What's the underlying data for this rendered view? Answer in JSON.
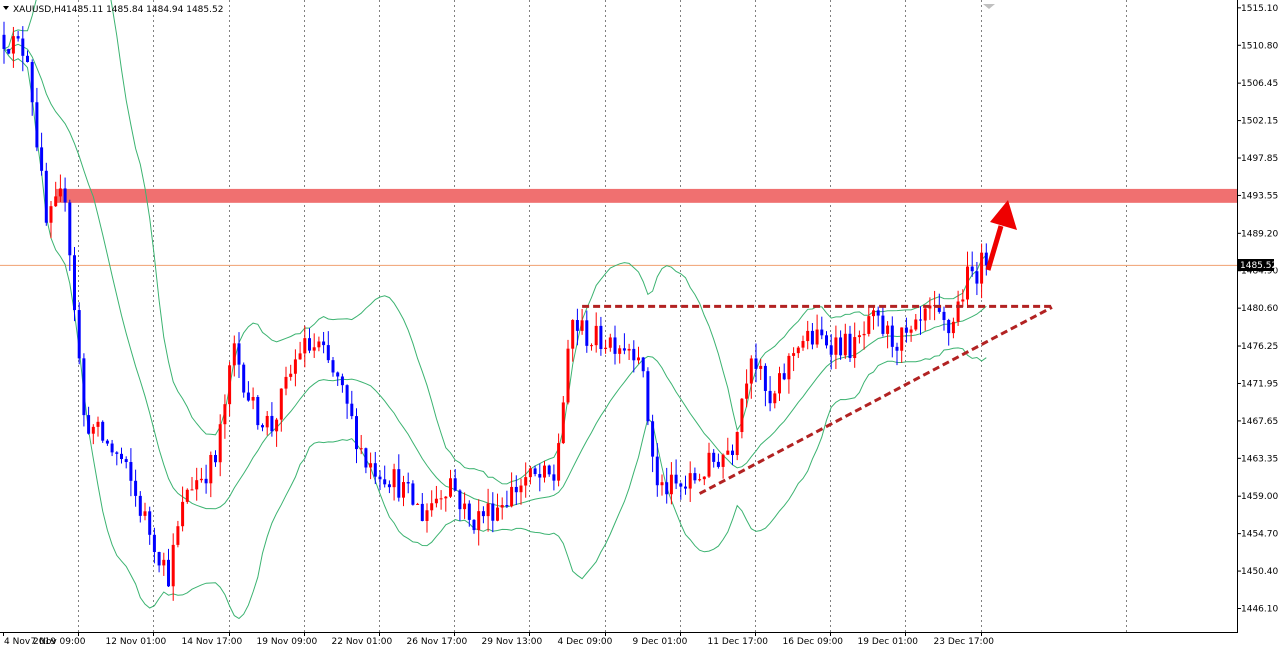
{
  "header": {
    "symbol": "XAUUSD,H4",
    "ohlc": "1485.11 1485.84 1484.94 1485.52"
  },
  "last_price_label": "1485.52",
  "colors": {
    "bull": "#ff0000",
    "bear": "#0000ff",
    "band": "#3cb371",
    "resistance_zone": "#f07070",
    "price_line": "#f0a070",
    "grid": "#808080",
    "pattern": "#b22222",
    "arrow": "#ee0000"
  },
  "chart_data": {
    "type": "candlestick",
    "instrument": "XAUUSD",
    "timeframe": "H4",
    "ylim": [
      1443.4,
      1516.0
    ],
    "y_ticks": [
      "1515.10",
      "1510.80",
      "1506.45",
      "1502.15",
      "1497.85",
      "1493.55",
      "1489.20",
      "1484.90",
      "1480.60",
      "1476.25",
      "1471.95",
      "1467.65",
      "1463.35",
      "1459.00",
      "1454.70",
      "1450.40",
      "1446.10"
    ],
    "x_ticks": [
      "4 Nov 2019",
      "7 Nov 09:00",
      "12 Nov 01:00",
      "14 Nov 17:00",
      "19 Nov 09:00",
      "22 Nov 01:00",
      "26 Nov 17:00",
      "29 Nov 13:00",
      "4 Dec 09:00",
      "9 Dec 01:00",
      "11 Dec 17:00",
      "16 Dec 09:00",
      "19 Dec 01:00",
      "23 Dec 17:00"
    ],
    "x_tick_index": [
      0,
      16,
      32,
      48,
      64,
      80,
      96,
      112,
      128,
      144,
      160,
      176,
      192,
      208
    ],
    "candle_count": 210,
    "price_path": [
      [
        0,
        1512
      ],
      [
        6,
        1510
      ],
      [
        10,
        1490
      ],
      [
        14,
        1494
      ],
      [
        18,
        1468
      ],
      [
        26,
        1463
      ],
      [
        32,
        1455
      ],
      [
        36,
        1450
      ],
      [
        40,
        1460
      ],
      [
        46,
        1463
      ],
      [
        50,
        1476
      ],
      [
        54,
        1469
      ],
      [
        58,
        1467
      ],
      [
        64,
        1476
      ],
      [
        68,
        1476
      ],
      [
        72,
        1472
      ],
      [
        78,
        1463
      ],
      [
        84,
        1461
      ],
      [
        90,
        1457
      ],
      [
        96,
        1461
      ],
      [
        100,
        1456
      ],
      [
        106,
        1458
      ],
      [
        112,
        1461
      ],
      [
        118,
        1461
      ],
      [
        122,
        1479
      ],
      [
        126,
        1477
      ],
      [
        130,
        1477
      ],
      [
        136,
        1476
      ],
      [
        140,
        1460
      ],
      [
        146,
        1460
      ],
      [
        150,
        1462
      ],
      [
        156,
        1465
      ],
      [
        160,
        1476
      ],
      [
        164,
        1469
      ],
      [
        170,
        1477
      ],
      [
        176,
        1477
      ],
      [
        182,
        1476
      ],
      [
        186,
        1479
      ],
      [
        190,
        1477
      ],
      [
        194,
        1477
      ],
      [
        198,
        1480
      ],
      [
        202,
        1478
      ],
      [
        206,
        1484
      ],
      [
        210,
        1486
      ]
    ],
    "bollinger_period": 20,
    "bollinger_deviation": 2,
    "resistance_zone": [
      1492.7,
      1494.3
    ],
    "current_price": 1485.52,
    "triangle_top": [
      1480.8,
      1480.8
    ],
    "triangle_bottom": [
      1459.3,
      1480.7
    ]
  }
}
